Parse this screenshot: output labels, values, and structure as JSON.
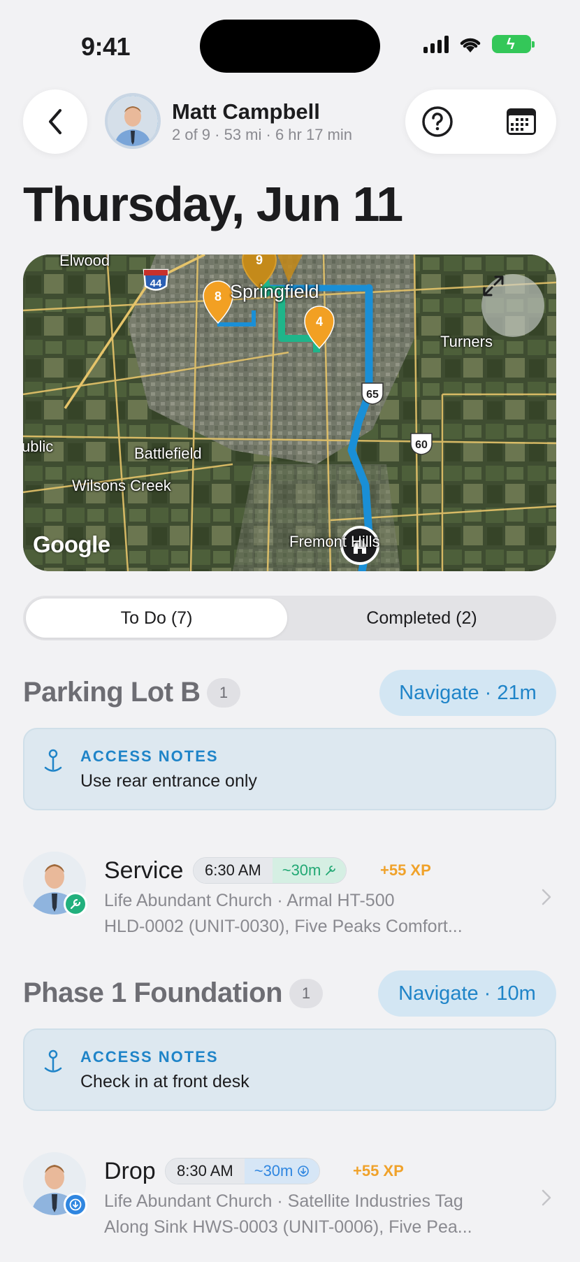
{
  "status_bar": {
    "time": "9:41"
  },
  "header": {
    "user_name": "Matt Campbell",
    "route_summary": "2 of 9 · 53 mi · 6 hr 17 min"
  },
  "page_title": "Thursday, Jun 11",
  "map": {
    "labels": {
      "elwood": "Elwood",
      "springfield": "Springfield",
      "turners": "Turners",
      "ublic": "ublic",
      "battlefield": "Battlefield",
      "wilsons_creek": "Wilsons Creek",
      "fremont": "Fremont Hills"
    },
    "shields": {
      "i44": "44",
      "us65": "65",
      "us60": "60"
    },
    "pins": [
      "9",
      "8",
      "4"
    ],
    "google": "Google",
    "colors": {
      "route_blue": "#1a8fd6",
      "route_green": "#1fb58a",
      "pin_orange": "#f2a023"
    }
  },
  "tabs": {
    "todo": "To Do (7)",
    "completed": "Completed (2)"
  },
  "sections": [
    {
      "title": "Parking Lot B",
      "count": "1",
      "navigate": "Navigate · 21m",
      "notes_label": "ACCESS NOTES",
      "notes_text": "Use rear entrance only",
      "stop": {
        "type": "Service",
        "time": "6:30 AM",
        "duration": "~30m",
        "xp": "+55 XP",
        "line1": "Life Abundant Church · Armal HT-500",
        "line2": "HLD-0002 (UNIT-0030), Five Peaks Comfort..."
      }
    },
    {
      "title": "Phase 1 Foundation",
      "count": "1",
      "navigate": "Navigate · 10m",
      "notes_label": "ACCESS NOTES",
      "notes_text": "Check in at front desk",
      "stop": {
        "type": "Drop",
        "time": "8:30 AM",
        "duration": "~30m",
        "xp": "+55 XP",
        "line1": "Life Abundant Church · Satellite Industries Tag",
        "line2": "Along Sink HWS-0003 (UNIT-0006), Five Pea..."
      }
    }
  ]
}
